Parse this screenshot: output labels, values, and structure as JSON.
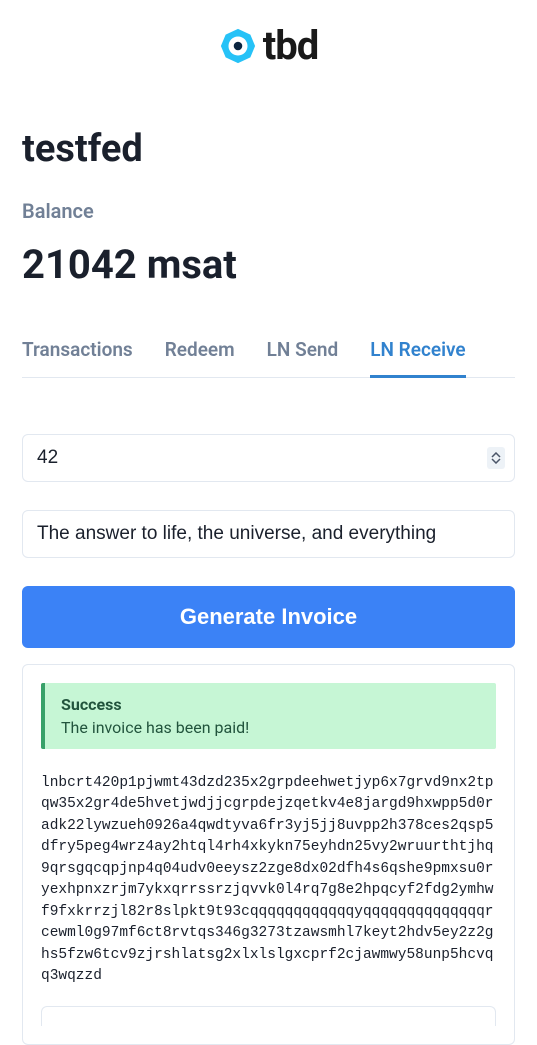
{
  "brand": {
    "name": "tbd",
    "accent": "#26c2f7"
  },
  "page": {
    "title": "testfed"
  },
  "balance": {
    "label": "Balance",
    "value": "21042 msat"
  },
  "tabs": [
    {
      "id": "transactions",
      "label": "Transactions",
      "active": false
    },
    {
      "id": "redeem",
      "label": "Redeem",
      "active": false
    },
    {
      "id": "ln-send",
      "label": "LN Send",
      "active": false
    },
    {
      "id": "ln-receive",
      "label": "LN Receive",
      "active": true
    }
  ],
  "form": {
    "amount": "42",
    "memo": "The answer to life, the universe, and everything",
    "submit_label": "Generate Invoice"
  },
  "alert": {
    "title": "Success",
    "message": "The invoice has been paid!"
  },
  "invoice": "lnbcrt420p1pjwmt43dzd235x2grpdeehwetjyp6x7grvd9nx2tpqw35x2gr4de5hvetjwdjjcgrpdejzqetkv4e8jargd9hxwpp5d0radk22lywzueh0926a4qwdtyva6fr3yj5jj8uvpp2h378ces2qsp5dfry5peg4wrz4ay2htql4rh4xkykn75eyhdn25vy2wruurthtjhq9qrsgqcqpjnp4q04udv0eeysz2zge8dx02dfh4s6qshe9pmxsu0ryexhpnxzrjm7ykxqrrssrzjqvvk0l4rq7g8e2hpqcyf2fdg2ymhwf9fxkrrzjl82r8slpkt9t93cqqqqqqqqqqqqyqqqqqqqqqqqqqqrcewml0g97mf6ct8rvtqs346g3273tzawsmhl7keyt2hdv5ey2z2ghs5fzw6tcv9zjrshlatsg2xlxlslgxcprf2cjawmwy58unp5hcvqq3wqzzd"
}
